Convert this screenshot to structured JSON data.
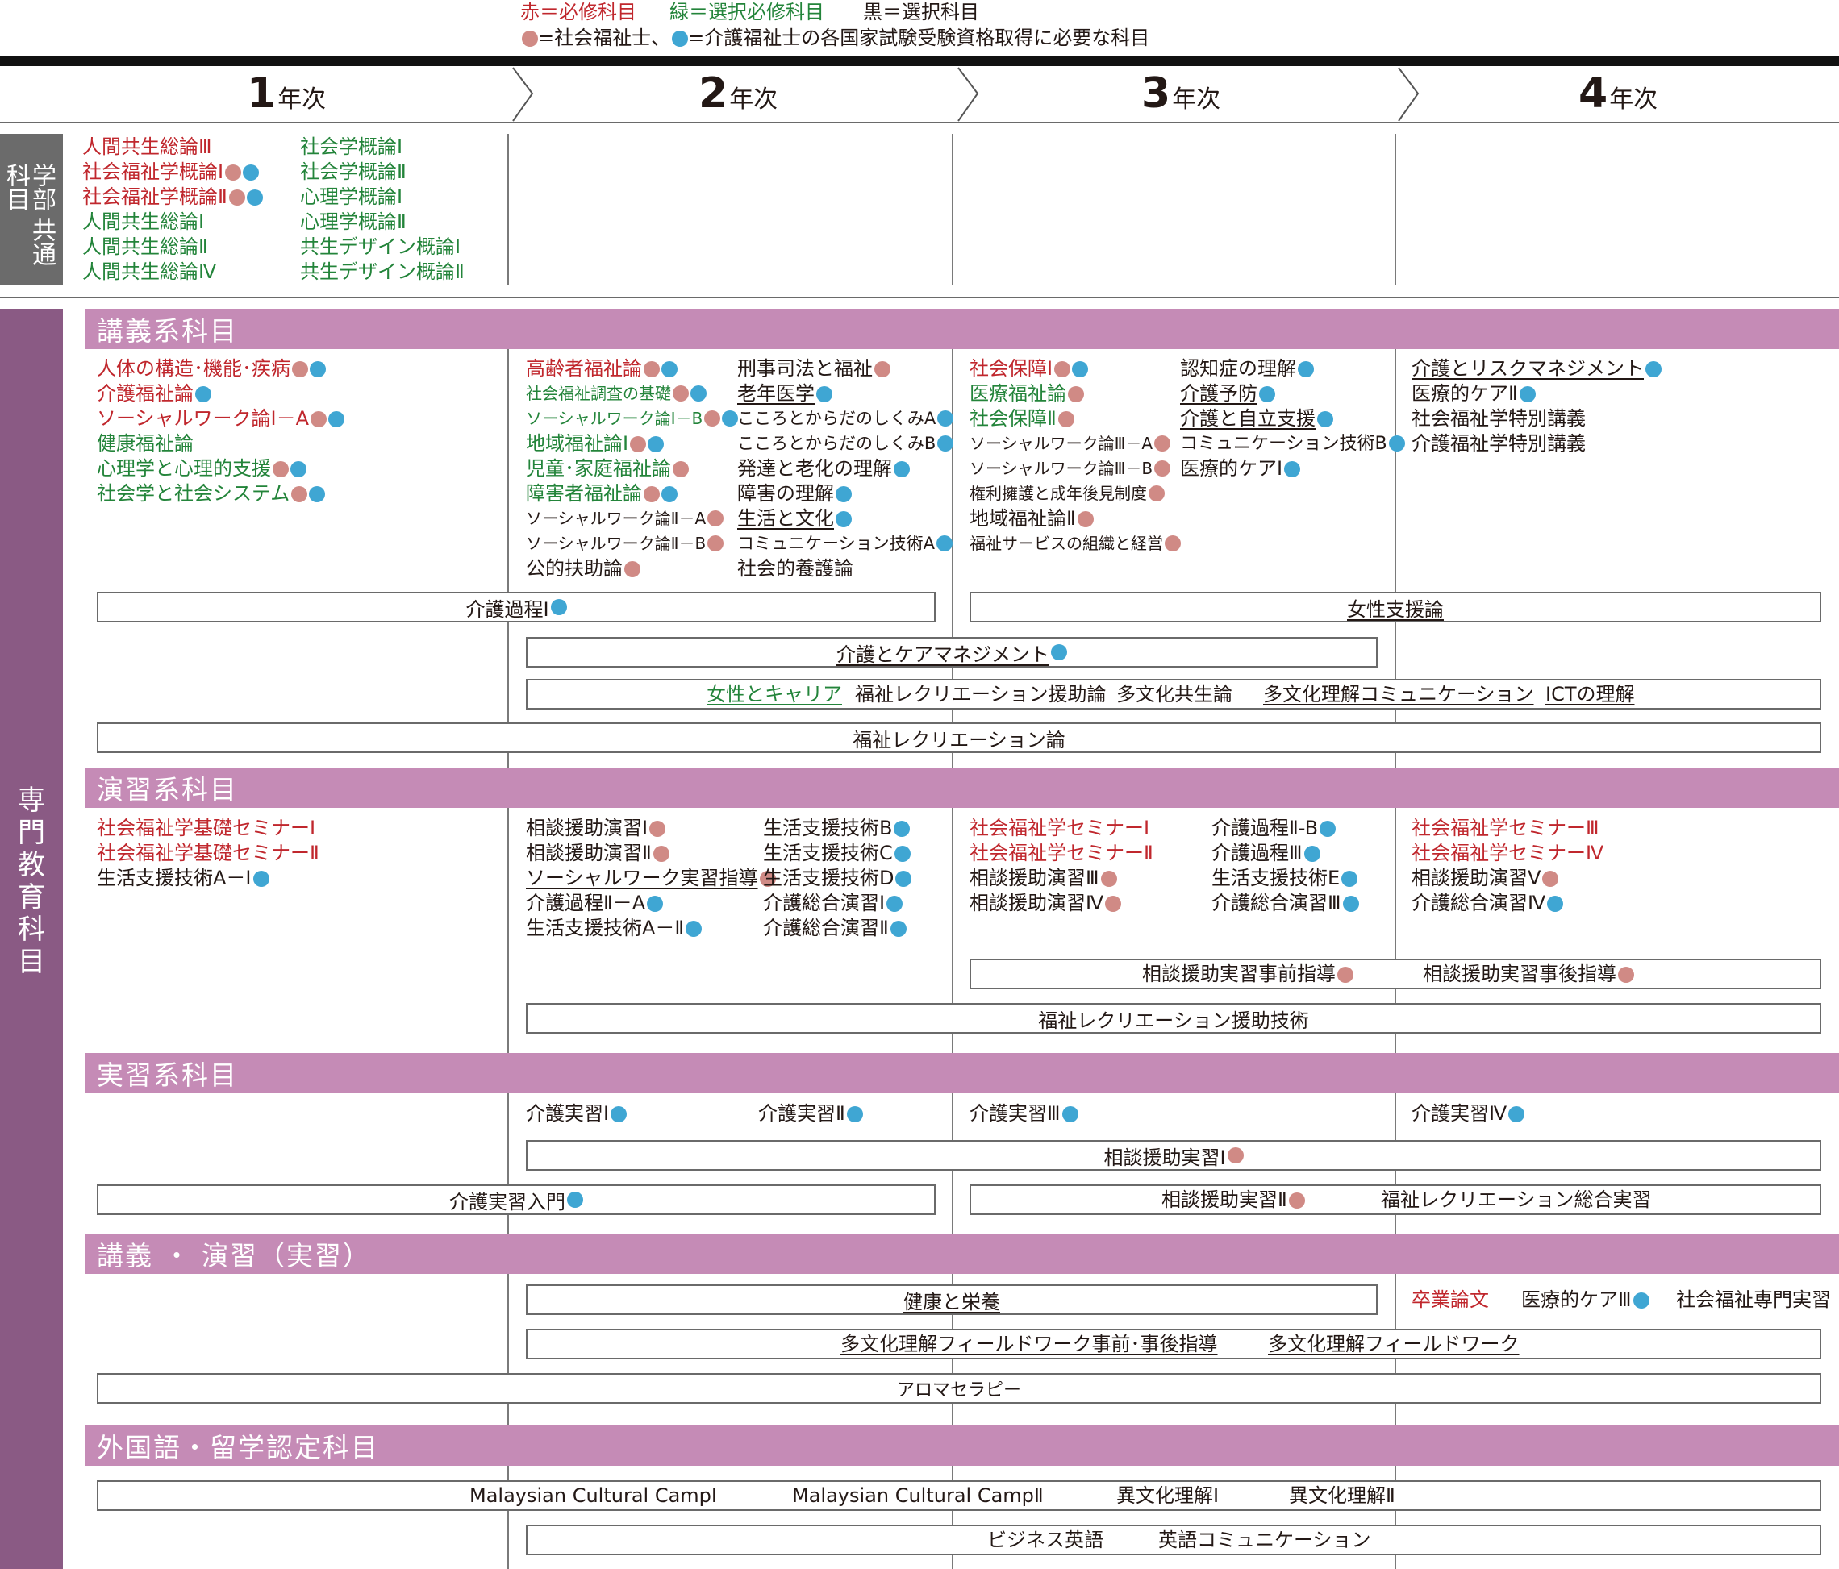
{
  "legend": {
    "red_label": "赤＝必修科目",
    "green_label": "緑＝選択必修科目",
    "black_label": "黒＝選択科目",
    "line2": "=社会福祉士、　=介護福祉士の各国家試験受験資格取得に必要な科目",
    "line2_a": "=社会福祉士、",
    "line2_b": "=介護福祉士の各国家試験受験資格取得に必要な科目"
  },
  "colors": {
    "required": "#c0272d",
    "selective_required": "#23843a",
    "elective": "#231815",
    "social_worker_dot": "#d08a85",
    "care_worker_dot": "#3fa6d3",
    "band": "#c58bb6",
    "sidebar_main": "#8a5a84",
    "sidebar_common": "#6b6b6b"
  },
  "years": [
    {
      "num": "1",
      "suffix": "年次"
    },
    {
      "num": "2",
      "suffix": "年次"
    },
    {
      "num": "3",
      "suffix": "年次"
    },
    {
      "num": "4",
      "suffix": "年次"
    }
  ],
  "sidebar": {
    "common": "科学部共通",
    "common_cols": [
      "科目",
      "学部",
      "共通"
    ],
    "main": "専門教育科目",
    "main_chars": [
      "専",
      "門",
      "教",
      "育",
      "科",
      "目"
    ]
  },
  "common_courses": {
    "col_a": [
      "人間共生総論Ⅲ",
      "社会福祉学概論Ⅰ",
      "社会福祉学概論Ⅱ",
      "人間共生総論Ⅰ",
      "人間共生総論Ⅱ",
      "人間共生総論Ⅳ"
    ],
    "col_b": [
      "社会学概論Ⅰ",
      "社会学概論Ⅱ",
      "心理学概論Ⅰ",
      "心理学概論Ⅱ",
      "共生デザイン概論Ⅰ",
      "共生デザイン概論Ⅱ"
    ]
  },
  "sections": {
    "lecture": "講義系科目",
    "seminar": "演習系科目",
    "practice": "実習系科目",
    "lecture_seminar": "講義 ・ 演習（実習）",
    "foreign": "外国語・留学認定科目"
  },
  "lecture": {
    "y1": [
      "人体の構造･機能･疾病",
      "介護福祉論",
      "ソーシャルワーク論Ⅰ－A",
      "健康福祉論",
      "心理学と心理的支援",
      "社会学と社会システム"
    ],
    "y2a": [
      "高齢者福祉論",
      "社会福祉調査の基礎",
      "ソーシャルワーク論Ⅰ－B",
      "地域福祉論Ⅰ",
      "児童･家庭福祉論",
      "障害者福祉論",
      "ソーシャルワーク論Ⅱ－A",
      "ソーシャルワーク論Ⅱ－B",
      "公的扶助論"
    ],
    "y2b": [
      "刑事司法と福祉",
      "老年医学",
      "こころとからだのしくみA",
      "こころとからだのしくみB",
      "発達と老化の理解",
      "障害の理解",
      "生活と文化",
      "コミュニケーション技術A",
      "社会的養護論"
    ],
    "y3a": [
      "社会保障Ⅰ",
      "医療福祉論",
      "社会保障Ⅱ",
      "ソーシャルワーク論Ⅲ－A",
      "ソーシャルワーク論Ⅲ－B",
      "権利擁護と成年後見制度",
      "地域福祉論Ⅱ",
      "福祉サービスの組織と経営"
    ],
    "y3b": [
      "認知症の理解",
      "介護予防",
      "介護と自立支援",
      "コミュニケーション技術B",
      "医療的ケアⅠ"
    ],
    "y4": [
      "介護とリスクマネジメント",
      "医療的ケアⅡ",
      "社会福祉学特別講義",
      "介護福祉学特別講義"
    ],
    "box_kaigo1": "介護過程Ⅰ",
    "box_josei": "女性支援論",
    "box_care_mgmt": "介護とケアマネジメント",
    "box_multi": [
      "女性とキャリア",
      "福祉レクリエーション援助論",
      "多文化共生論",
      "多文化理解コミュニケーション",
      "ICTの理解"
    ],
    "box_rec": "福祉レクリエーション論"
  },
  "seminar": {
    "y1": [
      "社会福祉学基礎セミナーⅠ",
      "社会福祉学基礎セミナーⅡ",
      "生活支援技術A－Ⅰ"
    ],
    "y2a": [
      "相談援助演習Ⅰ",
      "相談援助演習Ⅱ",
      "ソーシャルワーク実習指導",
      "介護過程Ⅱ－A",
      "生活支援技術A－Ⅱ"
    ],
    "y2b": [
      "生活支援技術B",
      "生活支援技術C",
      "生活支援技術D",
      "介護総合演習Ⅰ",
      "介護総合演習Ⅱ"
    ],
    "y3a": [
      "社会福祉学セミナーⅠ",
      "社会福祉学セミナーⅡ",
      "相談援助演習Ⅲ",
      "相談援助演習Ⅳ"
    ],
    "y3b": [
      "介護過程Ⅱ-B",
      "介護過程Ⅲ",
      "生活支援技術E",
      "介護総合演習Ⅲ"
    ],
    "y4": [
      "社会福祉学セミナーⅢ",
      "社会福祉学セミナーⅣ",
      "相談援助演習Ⅴ",
      "介護総合演習Ⅳ"
    ],
    "box_pre": "相談援助実習事前指導",
    "box_post": "相談援助実習事後指導",
    "box_rec_tech": "福祉レクリエーション援助技術"
  },
  "practice": {
    "y2a": "介護実習Ⅰ",
    "y2b": "介護実習Ⅱ",
    "y3": "介護実習Ⅲ",
    "y4": "介護実習Ⅳ",
    "box_soudan1": "相談援助実習Ⅰ",
    "box_intro": "介護実習入門",
    "box_soudan2": "相談援助実習Ⅱ",
    "box_rec_total": "福祉レクリエーション総合実習"
  },
  "lecture_seminar": {
    "box_health": "健康と栄養",
    "y4": [
      "卒業論文",
      "医療的ケアⅢ",
      "社会福祉専門実習"
    ],
    "box_field_pre": "多文化理解フィールドワーク事前･事後指導",
    "box_field": "多文化理解フィールドワーク",
    "box_aroma": "アロマセラピー"
  },
  "foreign": {
    "row1": [
      "Malaysian Cultural CampⅠ",
      "Malaysian Cultural CampⅡ",
      "異文化理解Ⅰ",
      "異文化理解Ⅱ"
    ],
    "row2": [
      "ビジネス英語",
      "英語コミュニケーション"
    ]
  }
}
